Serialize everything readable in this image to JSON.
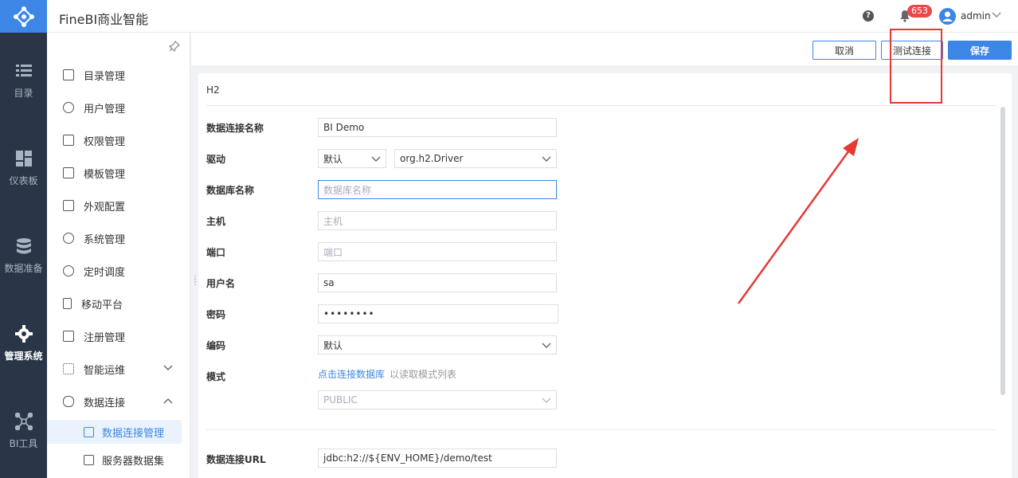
{
  "app": {
    "title": "FineBI商业智能"
  },
  "header": {
    "help_icon": "?",
    "notification_count": "653",
    "user": "admin"
  },
  "rail": [
    {
      "label": "目录",
      "icon": "list-icon"
    },
    {
      "label": "仪表板",
      "icon": "dashboard-icon"
    },
    {
      "label": "数据准备",
      "icon": "database-icon"
    },
    {
      "label": "管理系统",
      "icon": "gear-icon",
      "active": true
    },
    {
      "label": "BI工具",
      "icon": "network-icon"
    }
  ],
  "sidebar": {
    "items": [
      {
        "label": "目录管理"
      },
      {
        "label": "用户管理"
      },
      {
        "label": "权限管理"
      },
      {
        "label": "模板管理"
      },
      {
        "label": "外观配置"
      },
      {
        "label": "系统管理"
      },
      {
        "label": "定时调度"
      },
      {
        "label": "移动平台"
      },
      {
        "label": "注册管理"
      },
      {
        "label": "智能运维"
      },
      {
        "label": "数据连接"
      }
    ],
    "sub_items": [
      {
        "label": "数据连接管理",
        "active": true
      },
      {
        "label": "服务器数据集"
      }
    ]
  },
  "toolbar": {
    "cancel": "取消",
    "test": "测试连接",
    "save": "保存"
  },
  "form": {
    "db_type": "H2",
    "labels": {
      "name": "数据连接名称",
      "driver": "驱动",
      "dbname": "数据库名称",
      "host": "主机",
      "port": "端口",
      "username": "用户名",
      "password": "密码",
      "encoding": "编码",
      "schema": "模式",
      "url": "数据连接URL"
    },
    "values": {
      "name": "BI Demo",
      "driver_mode": "默认",
      "driver_class": "org.h2.Driver",
      "username": "sa",
      "password": "••••••••",
      "encoding": "默认",
      "schema": "PUBLIC",
      "url": "jdbc:h2://${ENV_HOME}/demo/test"
    },
    "placeholders": {
      "dbname": "数据库名称",
      "host": "主机",
      "port": "端口"
    },
    "schema_link": "点击连接数据库",
    "schema_hint": "以读取模式列表"
  },
  "colors": {
    "rail": "#2a3547",
    "accent": "#3d86e6",
    "annotation": "#e53935"
  }
}
